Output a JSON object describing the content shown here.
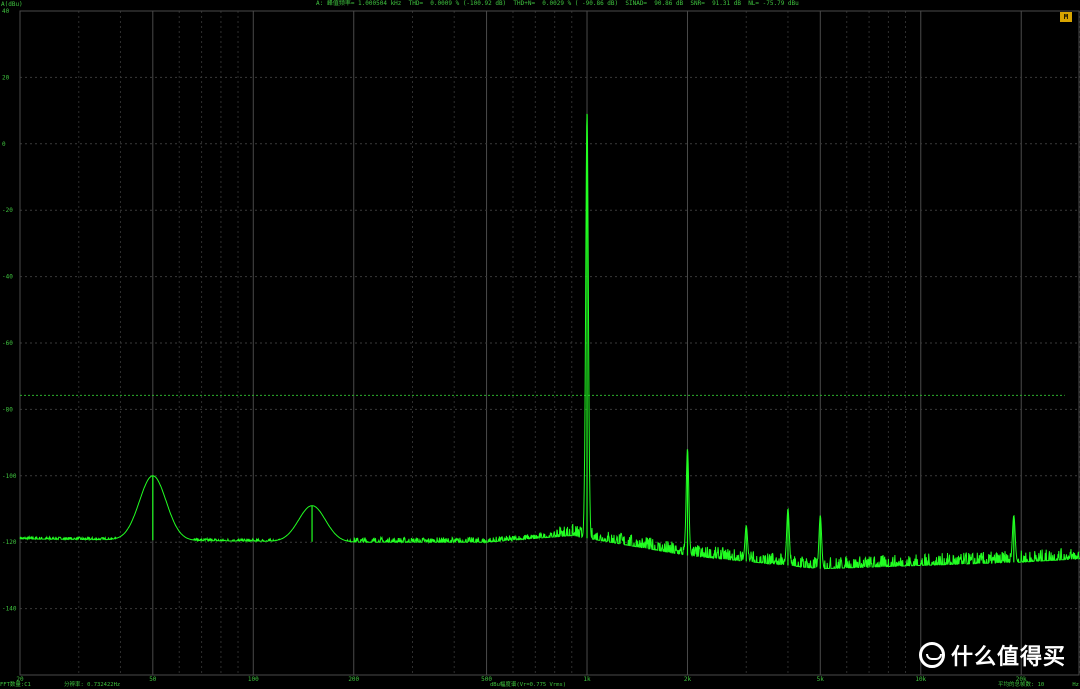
{
  "header": {
    "y_unit": "A(dBu)",
    "measurements": "A: 峰值频率= 1.000504 kHz  THD=  0.0009 % (-100.92 dB)  THD+N=  0.0029 % ( -90.86 dB)  SINAD=  90.86 dB  SNR=  91.31 dB  NL= -75.79 dBu",
    "badge": "M"
  },
  "footer": {
    "fft_label": "FFT数量:C1",
    "resolution_label": "分辨率: 0.732422Hz",
    "center_label": "dBu幅度谱(Vr=0.775 Vrms)",
    "avg_label": "平均的总帧数: 10",
    "hz_unit": "Hz"
  },
  "watermark": {
    "text": "什么值得买",
    "icon": "smzdm-logo-icon"
  },
  "colors": {
    "background": "#000000",
    "trace": "#22ff22",
    "grid": "#3a3a3a",
    "text": "#3fc43f",
    "noise_line": "#2cb02c"
  },
  "chart_data": {
    "type": "line",
    "title": "",
    "xlabel": "Hz",
    "ylabel": "A(dBu)",
    "x_scale": "log",
    "xlim": [
      20,
      30000
    ],
    "ylim": [
      -160,
      40
    ],
    "x_ticks": [
      20,
      50,
      100,
      200,
      500,
      1000,
      2000,
      5000,
      10000,
      20000
    ],
    "x_tick_labels": [
      "20",
      "50",
      "100",
      "200",
      "500",
      "1k",
      "2k",
      "5k",
      "10k",
      "20k"
    ],
    "y_ticks": [
      40,
      20,
      0,
      -20,
      -40,
      -60,
      -80,
      -100,
      -120,
      -140,
      -160
    ],
    "y_tick_labels": [
      "40",
      "20",
      "0",
      "-20",
      "-40",
      "-60",
      "-80",
      "-100",
      "-120",
      "-140",
      ""
    ],
    "grid": true,
    "noise_level_line": -75.79,
    "fundamental": {
      "freq": 1000,
      "level": 9
    },
    "peaks": [
      {
        "freq": 50,
        "level": -100
      },
      {
        "freq": 150,
        "level": -109
      },
      {
        "freq": 2000,
        "level": -92
      },
      {
        "freq": 3000,
        "level": -115
      },
      {
        "freq": 4000,
        "level": -110
      },
      {
        "freq": 5000,
        "level": -112
      },
      {
        "freq": 19000,
        "level": -112
      }
    ],
    "noise_floor": [
      {
        "freq": 20,
        "level": -119
      },
      {
        "freq": 200,
        "level": -120
      },
      {
        "freq": 500,
        "level": -120
      },
      {
        "freq": 900,
        "level": -118
      },
      {
        "freq": 2000,
        "level": -124
      },
      {
        "freq": 5000,
        "level": -128
      },
      {
        "freq": 20000,
        "level": -126
      },
      {
        "freq": 30000,
        "level": -125
      }
    ]
  }
}
